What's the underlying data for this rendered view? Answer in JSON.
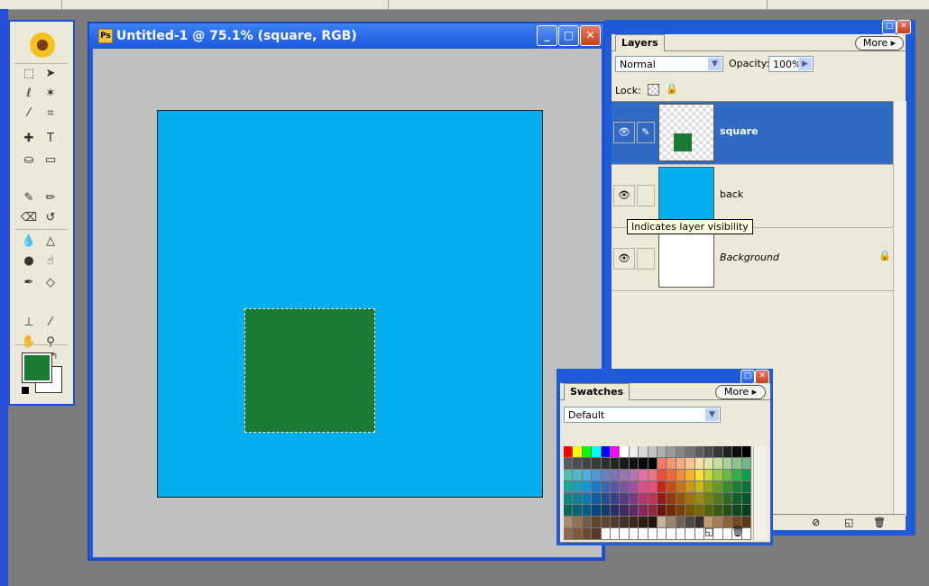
{
  "document": {
    "title": "Untitled-1 @ 75.1% (square, RGB)",
    "canvas_color": "#03aeef",
    "selection_color": "#1b7a34",
    "gray_bg": "#c0c0c0"
  },
  "window_buttons": {
    "minimize": "_",
    "maximize": "□",
    "close": "✕"
  },
  "toolbox": {
    "foreground_color": "#1b7a34",
    "background_color": "#ffffff",
    "tool_icons": [
      "marquee-icon",
      "move-icon",
      "lasso-icon",
      "magic-wand-icon",
      "slice-icon",
      "crop-icon",
      "healing-brush-icon",
      "type-icon",
      "paint-bucket-icon",
      "gradient-icon",
      "brush-icon",
      "pencil-icon",
      "eraser-icon",
      "history-brush-icon",
      "blur-icon",
      "sharpen-icon",
      "dodge-icon",
      "smudge-icon",
      "pen-icon",
      "shape-icon",
      "stamp-icon",
      "eyedropper-icon",
      "hand-icon",
      "zoom-icon"
    ]
  },
  "layers_panel": {
    "tab_label": "Layers",
    "more_label": "More",
    "blend_mode": "Normal",
    "opacity_label": "Opacity:",
    "opacity_value": "100%",
    "lock_label": "Lock:",
    "layers": [
      {
        "name": "square",
        "selected": true
      },
      {
        "name": "back",
        "selected": false
      },
      {
        "name": "Background",
        "selected": false
      }
    ],
    "tooltip": "Indicates layer visibility"
  },
  "swatches_panel": {
    "tab_label": "Swatches",
    "more_label": "More",
    "preset": "Default"
  },
  "swatch_colors": [
    [
      "#ff0000",
      "#ffff00",
      "#00ff00",
      "#00ffff",
      "#0000ff",
      "#ff00ff",
      "#ffffff",
      "#ebebeb",
      "#d7d7d7",
      "#c3c3c3",
      "#afafaf",
      "#9b9b9b",
      "#878787",
      "#737373",
      "#5f5f5f",
      "#4b4b4b",
      "#373737",
      "#232323",
      "#0f0f0f",
      "#000000"
    ],
    [
      "#5b5b5b",
      "#4f4f4f",
      "#444444",
      "#3a3a3a",
      "#2f2f2f",
      "#252525",
      "#1b1b1b",
      "#111111",
      "#080808",
      "#000000",
      "#f47c62",
      "#f69472",
      "#f8ac82",
      "#fac493",
      "#fce0a4",
      "#e6eaa0",
      "#c7df9c",
      "#a9d197",
      "#8cc490",
      "#6fb987"
    ],
    [
      "#4fbcad",
      "#4eb7c8",
      "#4eaede",
      "#4f95d8",
      "#6582c4",
      "#7d73b6",
      "#9776b3",
      "#b576ae",
      "#e671a0",
      "#ef7283",
      "#f04a3c",
      "#f26a3a",
      "#f68d35",
      "#f9b02f",
      "#fde234",
      "#c8d739",
      "#96c93e",
      "#64ba42",
      "#34ad47",
      "#00a14b"
    ],
    [
      "#15ac97",
      "#12a2b9",
      "#0d9ad5",
      "#1e78c8",
      "#3c66b0",
      "#5a56a4",
      "#7b53a1",
      "#9d509b",
      "#e04d8c",
      "#eb4d73",
      "#c5251b",
      "#c74f17",
      "#c97514",
      "#cb9a0f",
      "#caba0b",
      "#96a516",
      "#679a22",
      "#3a8a2d",
      "#1b7e36",
      "#00743a"
    ],
    [
      "#0b8a7a",
      "#0c8298",
      "#0a7bae",
      "#0f5ea2",
      "#254d8e",
      "#3b3f85",
      "#583b82",
      "#793a80",
      "#b3366f",
      "#bf345b",
      "#951a13",
      "#98390f",
      "#9a570c",
      "#9c7409",
      "#9a8c06",
      "#72800f",
      "#4e7819",
      "#2b6b21",
      "#145f29",
      "#00572c"
    ],
    [
      "#06695d",
      "#066374",
      "#055d85",
      "#08477c",
      "#173a6c",
      "#282f66",
      "#402c63",
      "#5a2a62",
      "#882854",
      "#932645",
      "#72120c",
      "#742a09",
      "#764207",
      "#775805",
      "#766a03",
      "#566109",
      "#3b5b10",
      "#205015",
      "#0d471d",
      "#00411f"
    ],
    [
      "#a98c6f",
      "#8f7456",
      "#765d41",
      "#5e4830",
      "#5f4633",
      "#533b2b",
      "#463124",
      "#3b271c",
      "#2f1e15",
      "#24160e",
      "#c7b299",
      "#998675",
      "#736357",
      "#534741",
      "#37302a",
      "#c69c6d",
      "#a67c52",
      "#8c6239",
      "#754c24",
      "#603913"
    ],
    [
      "#8f6a4a",
      "#7d5a3c",
      "#6b4a30",
      "#5a3c25",
      "#ffffff",
      "#ffffff",
      "#ffffff",
      "#ffffff",
      "#ffffff",
      "#ffffff",
      "#ffffff",
      "#ffffff",
      "#ffffff",
      "#ffffff",
      "#ffffff",
      "#ffffff",
      "#ffffff",
      "#ffffff",
      "#ffffff",
      "#ffffff"
    ]
  ]
}
